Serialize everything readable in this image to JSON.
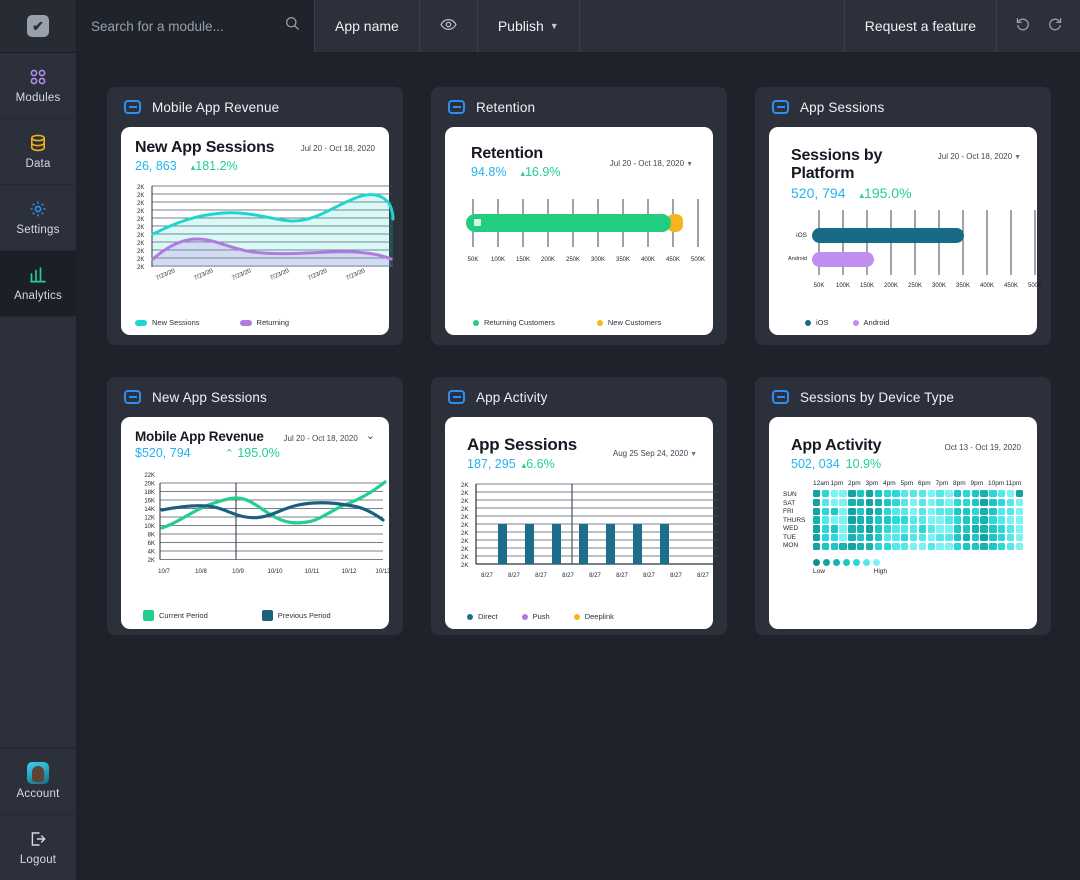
{
  "topbar": {
    "logo_icon": "checkbox-logo-icon",
    "search_placeholder": "Search for a module...",
    "search_value": "",
    "search_icon": "search-icon",
    "app_name": "App name",
    "preview_icon": "eye-icon",
    "publish": "Publish",
    "publish_caret_icon": "chevron-down-icon",
    "request_feature": "Request a feature",
    "undo_icon": "undo-icon",
    "redo_icon": "redo-icon"
  },
  "sidebar": {
    "items": [
      {
        "label": "Modules",
        "icon": "grid-dots-icon",
        "color": "#b18cf0",
        "active": false
      },
      {
        "label": "Data",
        "icon": "database-icon",
        "color": "#f2b116",
        "active": false
      },
      {
        "label": "Settings",
        "icon": "gear-icon",
        "color": "#2f8ef4",
        "active": false
      },
      {
        "label": "Analytics",
        "icon": "bar-chart-icon",
        "color": "#23cf8f",
        "active": true
      }
    ],
    "bottom": [
      {
        "label": "Account",
        "icon": "avatar-icon"
      },
      {
        "label": "Logout",
        "icon": "logout-icon"
      }
    ]
  },
  "panels": [
    {
      "title": "Mobile App Revenue",
      "icon": "collapse-icon"
    },
    {
      "title": "Retention",
      "icon": "collapse-icon"
    },
    {
      "title": "App Sessions",
      "icon": "collapse-icon"
    },
    {
      "title": "New App Sessions",
      "icon": "collapse-icon"
    },
    {
      "title": "App Activity",
      "icon": "collapse-icon"
    },
    {
      "title": "Sessions by Device Type",
      "icon": "collapse-icon"
    }
  ],
  "cards": {
    "new_app_sessions": {
      "title": "New App Sessions",
      "date": "Jul 20 - Oct 18, 2020",
      "value": "26, 863",
      "delta": "181.2%",
      "delta_arrow": "▴"
    },
    "retention": {
      "title": "Retention",
      "date": "Jul 20 - Oct 18, 2020",
      "value": "94.8%",
      "delta": "16.9%",
      "delta_arrow": "▴"
    },
    "sessions_by_platform": {
      "title": "Sessions by Platform",
      "date": "Jul 20 - Oct 18, 2020",
      "value": "520, 794",
      "delta": "195.0%",
      "delta_arrow": "▴"
    },
    "mobile_app_revenue": {
      "title": "Mobile App Revenue",
      "date": "Jul 20 - Oct 18, 2020",
      "value": "$520, 794",
      "delta": "195.0%",
      "delta_arrow": "⌃"
    },
    "app_sessions": {
      "title": "App Sessions",
      "date": "Aug 25 Sep 24, 2020",
      "value": "187, 295",
      "delta": "6.6%",
      "delta_arrow": "▴"
    },
    "app_activity": {
      "title": "App Activity",
      "date": "Oct 13 - Oct 19, 2020",
      "value": "502, 034",
      "delta": "10.9%",
      "delta_arrow": ""
    }
  },
  "chart_data": [
    {
      "id": "new-app-sessions-area",
      "type": "area",
      "title": "New App Sessions",
      "xlabel": "",
      "ylabel": "",
      "x": [
        "7/23/20",
        "7/23/20",
        "7/23/20",
        "7/23/20",
        "7/23/20",
        "7/23/20"
      ],
      "ytick_labels": [
        "2K",
        "2K",
        "2K",
        "2K",
        "2K",
        "2K",
        "2K",
        "2K",
        "2K",
        "2K",
        "2K",
        "2K",
        "2K"
      ],
      "grid": true,
      "legend_position": "bottom",
      "series": [
        {
          "name": "New Sessions",
          "color": "#1fd6cf",
          "values": [
            62,
            76,
            79,
            77,
            74,
            76,
            84,
            92,
            94,
            88,
            70
          ]
        },
        {
          "name": "Returning",
          "color": "#b07ae0",
          "values": [
            8,
            24,
            27,
            25,
            20,
            17,
            17,
            18,
            18,
            16,
            10
          ]
        }
      ]
    },
    {
      "id": "retention-bar",
      "type": "bar",
      "orientation": "horizontal",
      "title": "Retention",
      "xtick_labels": [
        "50K",
        "100K",
        "150K",
        "200K",
        "250K",
        "300K",
        "350K",
        "400K",
        "450K",
        "500K"
      ],
      "grid": true,
      "legend_position": "bottom",
      "series": [
        {
          "name": "Returning Customers",
          "color": "#22cd7f",
          "value": 400
        },
        {
          "name": "New Customers",
          "color": "#f5b51e",
          "value": 440
        }
      ]
    },
    {
      "id": "sessions-by-platform-bar",
      "type": "bar",
      "orientation": "horizontal",
      "title": "Sessions by Platform",
      "categories": [
        "iOS",
        "Android"
      ],
      "xtick_labels": [
        "50K",
        "100K",
        "150K",
        "200K",
        "250K",
        "300K",
        "350K",
        "400K",
        "450K",
        "500K"
      ],
      "grid": true,
      "legend_position": "bottom",
      "series": [
        {
          "name": "iOS",
          "color": "#176b86",
          "value": 380
        },
        {
          "name": "Android",
          "color": "#c08df0",
          "value": 145
        }
      ]
    },
    {
      "id": "mobile-app-revenue-line",
      "type": "line",
      "title": "Mobile App Revenue",
      "x": [
        "10/7",
        "10/8",
        "10/9",
        "10/10",
        "10/11",
        "10/12",
        "10/13"
      ],
      "ytick_labels": [
        "22K",
        "20K",
        "18K",
        "16K",
        "14K",
        "12K",
        "10K",
        "8K",
        "6K",
        "4K",
        "2K"
      ],
      "ylim": [
        2000,
        22000
      ],
      "grid": true,
      "legend_position": "bottom",
      "series": [
        {
          "name": "Current Period",
          "color": "#23cf8f",
          "values": [
            10400,
            15000,
            17500,
            15000,
            12500,
            14500,
            20200
          ]
        },
        {
          "name": "Previous Period",
          "color": "#1d5f7e",
          "values": [
            14600,
            15200,
            14000,
            13000,
            15600,
            16000,
            12800
          ]
        }
      ]
    },
    {
      "id": "app-sessions-bar",
      "type": "bar",
      "orientation": "vertical",
      "title": "App Sessions",
      "x": [
        "8/27",
        "8/27",
        "8/27",
        "8/27",
        "8/27",
        "8/27",
        "8/27",
        "8/27",
        "8/27"
      ],
      "ytick_labels": [
        "2K",
        "2K",
        "2K",
        "2K",
        "2K",
        "2K",
        "2K",
        "2K",
        "2K",
        "2K",
        "2K",
        "2K"
      ],
      "grid": true,
      "legend_position": "bottom",
      "series": [
        {
          "name": "Direct",
          "color": "#1d6e8c",
          "values": [
            48,
            48,
            48,
            48,
            48,
            48,
            48,
            0,
            0
          ]
        },
        {
          "name": "Push",
          "color": "#b07ae0",
          "values": [
            0,
            0,
            0,
            0,
            0,
            0,
            0,
            0,
            0
          ]
        },
        {
          "name": "Deeplink",
          "color": "#f5b51e",
          "values": [
            0,
            0,
            0,
            0,
            0,
            0,
            0,
            0,
            0
          ]
        }
      ]
    },
    {
      "id": "app-activity-heatmap",
      "type": "heatmap",
      "title": "App Activity",
      "x": [
        "12am",
        "1pm",
        "2pm",
        "3pm",
        "4pm",
        "5pm",
        "6pm",
        "7pm",
        "8pm",
        "9pm",
        "10pm",
        "11pm"
      ],
      "y": [
        "SUN",
        "SAT",
        "FRI",
        "THURS",
        "WED",
        "TUE",
        "MON"
      ],
      "legend_low": "Low",
      "legend_high": "High",
      "scale_colors": [
        "#0e8f8f",
        "#13a3a3",
        "#17b3b3",
        "#1ec6c6",
        "#2ad8d8",
        "#55e8e8",
        "#7cf3f3"
      ],
      "values": [
        [
          1,
          4,
          6,
          6,
          1,
          3,
          1,
          3,
          4,
          4,
          5,
          5,
          5,
          6,
          5,
          6,
          3,
          4,
          3,
          2,
          4,
          5,
          6,
          1
        ],
        [
          1,
          5,
          6,
          6,
          2,
          2,
          1,
          2,
          3,
          4,
          5,
          6,
          5,
          6,
          5,
          6,
          4,
          4,
          3,
          1,
          3,
          4,
          5,
          6
        ],
        [
          1,
          4,
          3,
          6,
          1,
          3,
          1,
          2,
          4,
          5,
          5,
          6,
          5,
          6,
          5,
          5,
          3,
          3,
          4,
          2,
          3,
          5,
          5,
          6
        ],
        [
          2,
          5,
          6,
          6,
          1,
          2,
          2,
          3,
          3,
          4,
          4,
          5,
          5,
          6,
          6,
          5,
          4,
          3,
          3,
          2,
          4,
          5,
          6,
          6
        ],
        [
          1,
          4,
          3,
          6,
          2,
          2,
          1,
          3,
          4,
          5,
          5,
          5,
          4,
          5,
          6,
          6,
          3,
          3,
          2,
          2,
          3,
          4,
          5,
          6
        ],
        [
          1,
          4,
          4,
          6,
          2,
          3,
          2,
          3,
          5,
          5,
          4,
          5,
          5,
          6,
          5,
          5,
          3,
          2,
          3,
          1,
          3,
          4,
          5,
          6
        ],
        [
          1,
          3,
          3,
          2,
          1,
          2,
          2,
          4,
          4,
          5,
          5,
          6,
          6,
          5,
          6,
          6,
          4,
          3,
          3,
          2,
          3,
          4,
          5,
          6
        ]
      ]
    }
  ]
}
